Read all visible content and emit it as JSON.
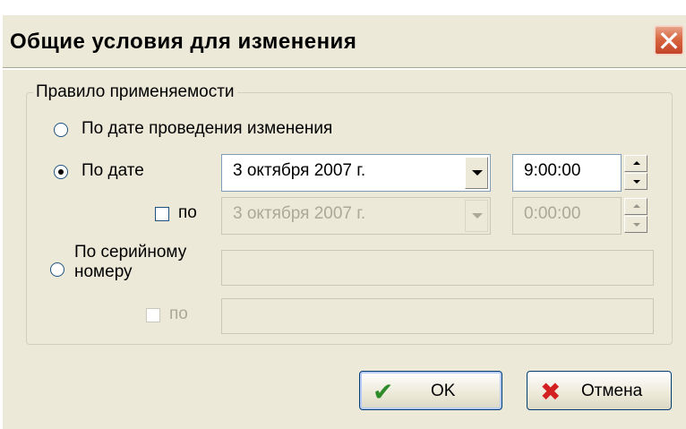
{
  "dialog": {
    "title": "Общие условия для изменения",
    "close_glyph": "✕"
  },
  "group": {
    "legend": "Правило применяемости",
    "by_change_date": {
      "label": "По дате проведения изменения",
      "selected": false
    },
    "by_date": {
      "label": "По дате",
      "selected": true,
      "date_value": "3 октября 2007 г.",
      "time_value": "9:00:00",
      "to_label": "по",
      "to_checked": false,
      "to_date_value": "3 октября 2007 г.",
      "to_time_value": "0:00:00"
    },
    "by_serial": {
      "label_line1": "По серийному",
      "label_line2": "номеру",
      "selected": false,
      "value": "",
      "to_label": "по",
      "to_value": ""
    }
  },
  "buttons": {
    "ok_label": "OK",
    "cancel_label": "Отмена"
  },
  "icons": {
    "ok": "check-icon",
    "cancel": "cross-icon",
    "dropdown": "chevron-down-icon",
    "close": "close-icon"
  },
  "colors": {
    "dialog_bg": "#ece9d8",
    "close_button": "#d8663f",
    "check_icon": "#2e8b2a",
    "cross_icon": "#d32020",
    "disabled_text": "#aca899"
  }
}
